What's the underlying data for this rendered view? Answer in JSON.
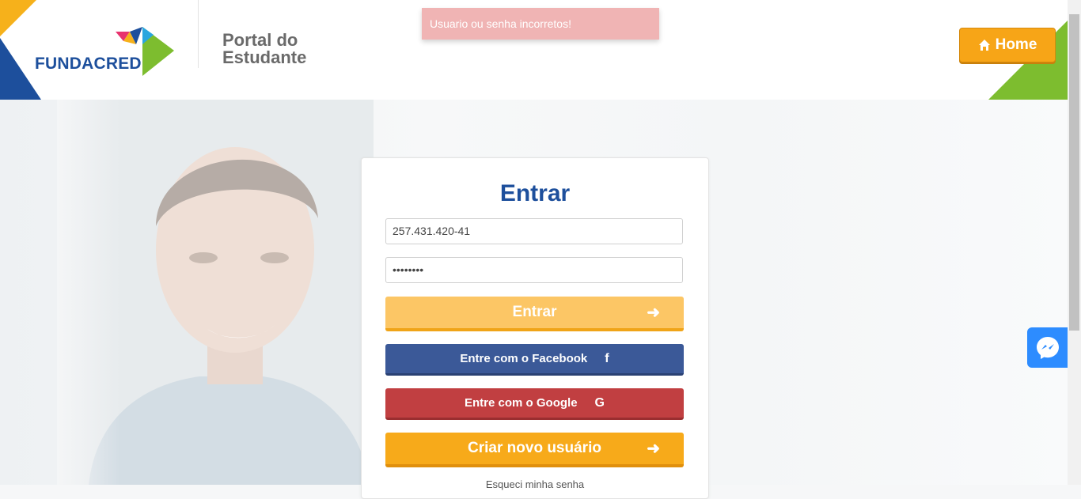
{
  "header": {
    "logo_text": "FUNDACRED",
    "portal_line1": "Portal do",
    "portal_line2": "Estudante",
    "home_label": "Home",
    "home_icon": "home-icon"
  },
  "alert": {
    "message": "Usuario ou senha incorretos!"
  },
  "login": {
    "title": "Entrar",
    "username_value": "257.431.420-41",
    "password_value": "••••••••",
    "entrar_label": "Entrar",
    "facebook_label": "Entre com o Facebook",
    "google_label": "Entre com o Google",
    "criar_label": "Criar novo usuário",
    "forgot_label": "Esqueci minha senha"
  },
  "colors": {
    "brand_blue": "#1d4f9c",
    "accent_orange": "#f7a517",
    "facebook": "#3b5998",
    "google": "#c13f41",
    "alert_bg": "#f0b4b4",
    "messenger": "#2d8cff"
  }
}
